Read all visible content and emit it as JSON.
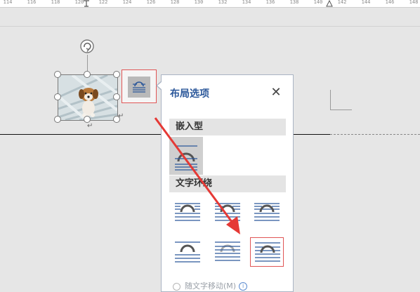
{
  "ruler": {
    "ticks": [
      "114",
      "116",
      "118",
      "120",
      "122",
      "124",
      "126",
      "128",
      "130",
      "132",
      "134",
      "136",
      "138",
      "140",
      "142",
      "144",
      "146",
      "148"
    ]
  },
  "layout_panel": {
    "title": "布局选项",
    "close_icon": "close-icon",
    "section_inline": "嵌入型",
    "section_wrap": "文字环绕",
    "bottom_option": "随文字移动(M)"
  },
  "colors": {
    "accent_blue": "#2b579a",
    "highlight_red": "#e05555",
    "arrow_red": "#e53935"
  }
}
